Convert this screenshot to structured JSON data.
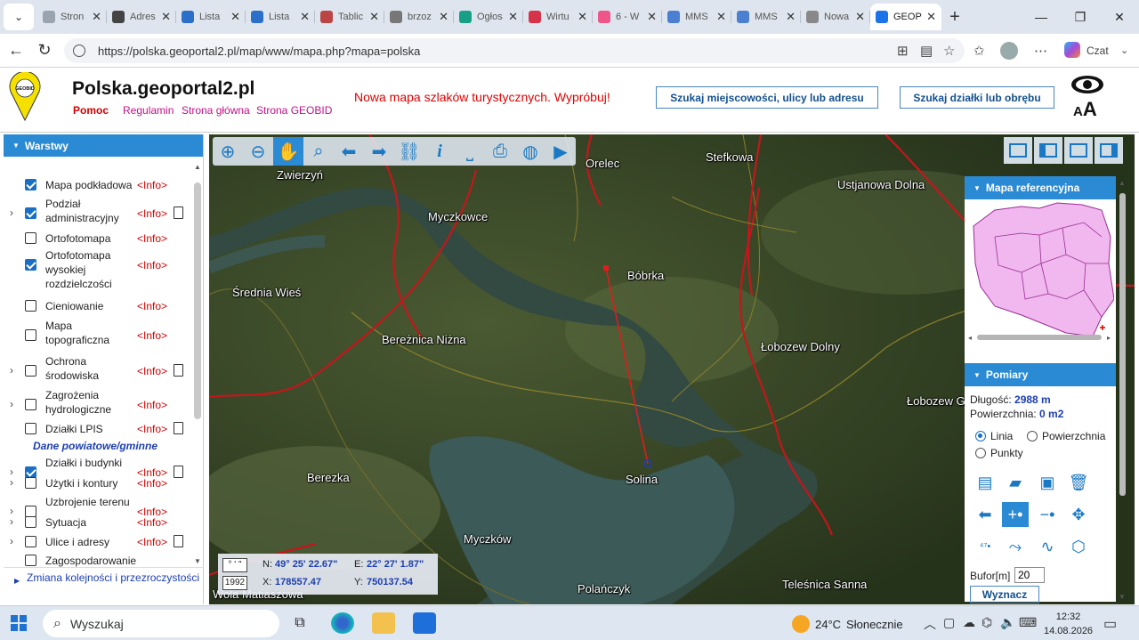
{
  "browser": {
    "tabs": [
      {
        "label": "Stron",
        "color": "#9aa3b0"
      },
      {
        "label": "Adres",
        "color": "#444"
      },
      {
        "label": "Lista",
        "color": "#2b6fc9"
      },
      {
        "label": "Lista",
        "color": "#2b6fc9"
      },
      {
        "label": "Tablic",
        "color": "#b44"
      },
      {
        "label": "brzoz",
        "color": "#777"
      },
      {
        "label": "Ogłos",
        "color": "#17a085"
      },
      {
        "label": "Wirtu",
        "color": "#d6334a"
      },
      {
        "label": "6 - W",
        "color": "#e58"
      },
      {
        "label": "MMS",
        "color": "#4a7fd1"
      },
      {
        "label": "MMS",
        "color": "#4a7fd1"
      },
      {
        "label": "Nowa",
        "color": "#888"
      },
      {
        "label": "GEOP",
        "color": "#1a73e8"
      }
    ],
    "url": "https://polska.geoportal2.pl/map/www/mapa.php?mapa=polska",
    "copilot_label": "Czat"
  },
  "header": {
    "title": "Polska.geoportal2.pl",
    "logo_text": "GEOBID",
    "links": [
      "Pomoc",
      "Regulamin",
      "Strona główna",
      "Strona GEOBID"
    ],
    "promo": "Nowa mapa szlaków turystycznych. Wypróbuj!",
    "search_address": "Szukaj miejscowości, ulicy lub adresu",
    "search_parcel": "Szukaj działki lub obrębu",
    "font_size_label": "AA"
  },
  "layers_panel": {
    "title": "Warstwy",
    "items": [
      {
        "label": "Mapa podkładowa",
        "info": "<Info>",
        "checked": true,
        "expand": false,
        "icon": ""
      },
      {
        "label": "Podział administracyjny",
        "info": "<Info>",
        "checked": true,
        "expand": true,
        "icon": "doc-icon"
      },
      {
        "label": "Ortofotomapa",
        "info": "<Info>",
        "checked": false,
        "expand": false,
        "icon": ""
      },
      {
        "label": "Ortofotomapa wysokiej rozdzielczości",
        "info": "<Info>",
        "checked": true,
        "expand": false,
        "icon": ""
      },
      {
        "label": "Cieniowanie",
        "info": "<Info>",
        "checked": false,
        "expand": false,
        "icon": ""
      },
      {
        "label": "Mapa topograficzna",
        "info": "<Info>",
        "checked": false,
        "expand": false,
        "icon": ""
      },
      {
        "label": "Ochrona środowiska",
        "info": "<Info>",
        "checked": false,
        "expand": true,
        "icon": "doc-icon"
      },
      {
        "label": "Zagrożenia hydrologiczne",
        "info": "<Info>",
        "checked": false,
        "expand": true,
        "icon": ""
      },
      {
        "label": "Działki LPIS",
        "info": "<Info>",
        "checked": false,
        "expand": false,
        "icon": "doc-icon"
      },
      {
        "label": "Działki i budynki",
        "info": "<Info>",
        "checked": true,
        "expand": true,
        "icon": "doc-icon"
      },
      {
        "label": "Użytki i kontury",
        "info": "<Info>",
        "checked": false,
        "expand": true,
        "icon": ""
      },
      {
        "label": "Uzbrojenie terenu",
        "info": "<Info>",
        "checked": false,
        "expand": true,
        "icon": ""
      },
      {
        "label": "Sytuacja",
        "info": "<Info>",
        "checked": false,
        "expand": true,
        "icon": ""
      },
      {
        "label": "Ulice i adresy",
        "info": "<Info>",
        "checked": false,
        "expand": true,
        "icon": "doc-icon"
      },
      {
        "label": "Zagospodarowanie",
        "info": "",
        "checked": false,
        "expand": false,
        "icon": ""
      }
    ],
    "group_label": "Dane powiatowe/gminne",
    "footer": "Zmiana kolejności i przezroczystości"
  },
  "map": {
    "places": [
      "Zwierzyń",
      "Orelec",
      "Stefkowa",
      "Ustjanowa Dolna",
      "Myczkowce",
      "Bóbrka",
      "Średnia Wieś",
      "Bereżnica Niżna",
      "Łobozew Dolny",
      "Łobozew G",
      "Berezka",
      "Solina",
      "Myczków",
      "Polańczyk",
      "Teleśnica Sanna",
      "Wola Matiaszowa"
    ],
    "coords": {
      "format_label": "° ' \"",
      "system_label": "1992",
      "n_label": "N:",
      "n_value": "49° 25' 22.67\"",
      "e_label": "E:",
      "e_value": "22° 27' 1.87\"",
      "x_label": "X:",
      "x_value": "178557.47",
      "y_label": "Y:",
      "y_value": "750137.54"
    }
  },
  "right_panel": {
    "ref_title": "Mapa referencyjna",
    "meas_title": "Pomiary",
    "length_label": "Długość:",
    "length_value": "2988 m",
    "area_label": "Powierzchnia:",
    "area_value": "0 m2",
    "modes": [
      "Linia",
      "Powierzchnia",
      "Punkty"
    ],
    "selected_mode": "Linia",
    "bufor_label": "Bufor[m]",
    "bufor_value": "20",
    "compute_label": "Wyznacz"
  },
  "taskbar": {
    "search_placeholder": "Wyszukaj",
    "weather_temp": "24°C",
    "weather_text": "Słonecznie",
    "time": "12:32",
    "date": "14.08.2026"
  }
}
